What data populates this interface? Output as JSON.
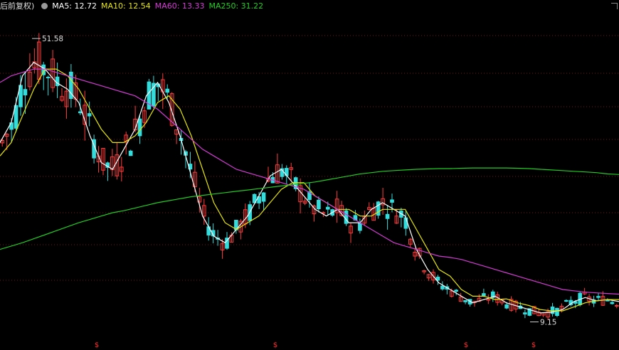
{
  "legend": {
    "adjust_label": "后前复权)",
    "ma5": "MA5: 12.72",
    "ma10": "MA10: 12.54",
    "ma60": "MA60: 13.33",
    "ma250": "MA250: 31.22"
  },
  "colors": {
    "up": "#ff3c3c",
    "down": "#33dddd",
    "ma5": "#ffffff",
    "ma10": "#e6e60a",
    "ma60": "#d43ad4",
    "ma250": "#22cc22",
    "grid": "#7a1414",
    "marker": "#ff3333"
  },
  "markers": {
    "symbol": "$"
  },
  "chart_data": {
    "type": "candlestick",
    "y_range": [
      7.5,
      55
    ],
    "high_label": "51.58",
    "low_label": "9.15",
    "ma_series": [
      {
        "name": "MA5",
        "values": [
          36,
          39,
          46,
          48,
          47,
          45,
          44,
          42,
          37,
          33,
          32,
          35,
          38,
          43,
          45,
          42,
          37,
          31,
          25,
          22,
          21,
          23,
          25,
          28,
          31,
          32,
          30,
          28,
          26,
          25,
          26,
          24,
          24,
          26,
          27,
          26,
          25,
          20,
          17,
          15,
          14,
          13,
          12,
          12.5,
          13,
          12,
          11.5,
          11,
          10.5,
          10.6,
          11,
          12.2,
          12.8,
          12.3,
          12.5,
          12.2
        ]
      },
      {
        "name": "MA10",
        "values": [
          34,
          36,
          40,
          44,
          47,
          47,
          46,
          44,
          41,
          38,
          36,
          36,
          37,
          39,
          42,
          43,
          41,
          37,
          32,
          27,
          24,
          23,
          24,
          25,
          27,
          29,
          30,
          30,
          28,
          27,
          26,
          26,
          25,
          25,
          26,
          26,
          26,
          23,
          20,
          17,
          16,
          14,
          13,
          13,
          12.5,
          12.6,
          12,
          11.6,
          11,
          10.8,
          10.8,
          11.4,
          12,
          12.3,
          12.5,
          12.5
        ]
      },
      {
        "name": "MA60",
        "values": [
          45,
          46,
          46.5,
          47,
          47,
          46.5,
          46,
          45.5,
          45,
          44.5,
          44,
          43.5,
          43,
          42,
          41,
          39.5,
          38,
          36.5,
          35,
          34,
          33,
          32,
          31.5,
          31,
          30.5,
          30,
          29.5,
          29,
          28,
          27,
          26,
          25,
          24,
          23,
          22,
          21,
          20.5,
          20,
          19.5,
          19,
          18.8,
          18.5,
          18,
          17.5,
          17,
          16.5,
          16,
          15.5,
          15,
          14.5,
          14,
          13.8,
          13.6,
          13.5,
          13.4,
          13.3
        ]
      },
      {
        "name": "MA250",
        "values": [
          20,
          20.5,
          21,
          21.6,
          22.2,
          22.8,
          23.4,
          24,
          24.5,
          25,
          25.5,
          25.8,
          26.2,
          26.6,
          27,
          27.3,
          27.6,
          27.9,
          28.1,
          28.3,
          28.5,
          28.7,
          28.9,
          29.1,
          29.3,
          29.5,
          29.7,
          29.9,
          30.1,
          30.4,
          30.7,
          31,
          31.3,
          31.5,
          31.7,
          31.8,
          31.9,
          32,
          32.05,
          32.1,
          32.1,
          32.15,
          32.2,
          32.2,
          32.2,
          32.2,
          32.15,
          32.1,
          32,
          31.9,
          31.8,
          31.7,
          31.6,
          31.5,
          31.3,
          31.22
        ]
      }
    ]
  }
}
